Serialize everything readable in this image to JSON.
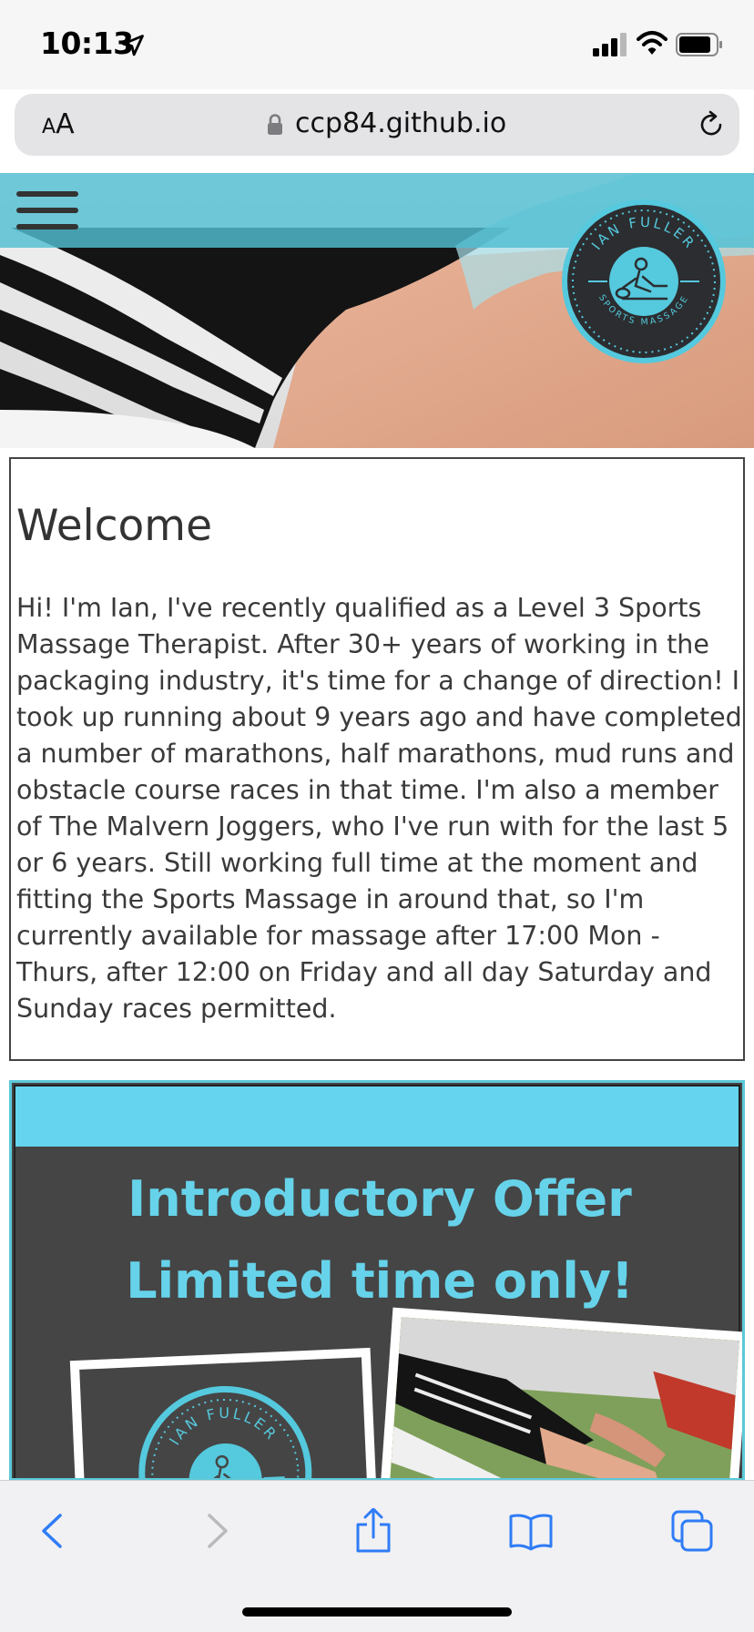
{
  "status_bar": {
    "time": "10:13"
  },
  "browser": {
    "aa_label_small": "A",
    "aa_label_large": "A",
    "url": "ccp84.github.io"
  },
  "logo": {
    "text_top": "IAN FULLER",
    "text_bottom": "SPORTS MASSAGE"
  },
  "welcome": {
    "title": "Welcome",
    "body": "Hi! I'm Ian, I've recently qualified as a Level 3 Sports Massage Therapist. After 30+ years of working in the packaging industry, it's time for a change of direction! I took up running about 9 years ago and have completed a number of marathons, half marathons, mud runs and obstacle course races in that time. I'm also a member of The Malvern Joggers, who I've run with for the last 5 or 6 years. Still working full time at the moment and fitting the Sports Massage in around that, so I'm currently available for massage after 17:00 Mon - Thurs, after 12:00 on Friday and all day Saturday and Sunday races permitted."
  },
  "offer": {
    "line1": "Introductory Offer",
    "line2": "Limited time only!",
    "logo_text": "IAN FULLER"
  },
  "colors": {
    "accent": "#5cc8d8",
    "offer_text": "#66d3ea",
    "offer_bg": "#454545",
    "toolbar_icon": "#2f7cf6",
    "toolbar_icon_disabled": "#b9b9be"
  },
  "icons": {
    "location": "location-arrow-icon",
    "signal": "cellular-signal-icon",
    "wifi": "wifi-icon",
    "battery": "battery-icon",
    "lock": "lock-icon",
    "reload": "reload-icon",
    "menu": "hamburger-menu-icon",
    "back": "back-chevron-icon",
    "forward": "forward-chevron-icon",
    "share": "share-icon",
    "bookmarks": "bookmarks-icon",
    "tabs": "tabs-icon"
  }
}
